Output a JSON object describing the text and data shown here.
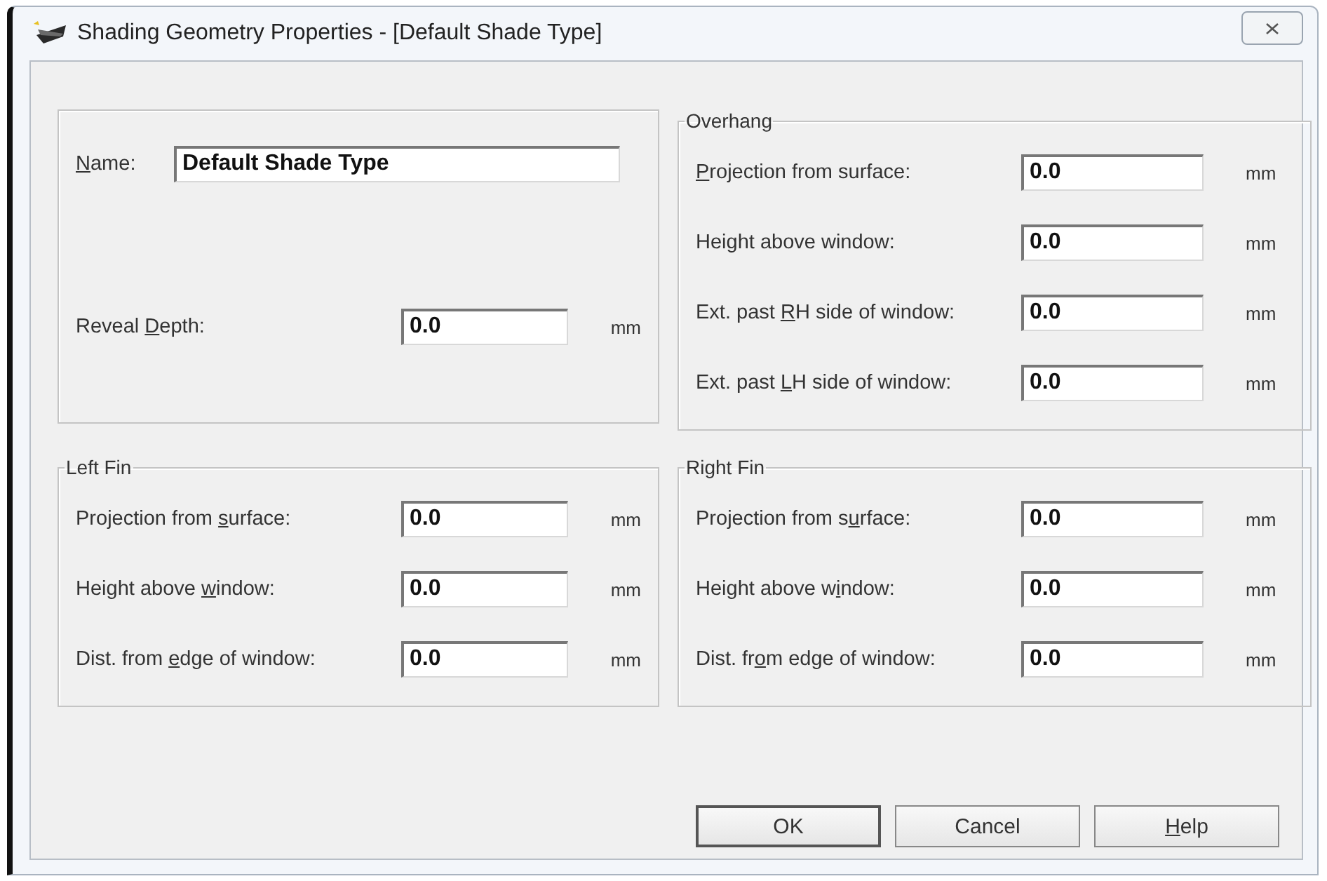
{
  "window": {
    "title": "Shading Geometry Properties - [Default Shade Type]"
  },
  "general": {
    "fields": [
      {
        "kind": "text",
        "key": "N",
        "post": "ame:",
        "value": "Default Shade Type"
      },
      {
        "kind": "measure",
        "pre": "Reveal ",
        "key": "D",
        "post": "epth:",
        "value": "0.0",
        "unit": "mm"
      }
    ]
  },
  "groups": [
    {
      "title": "Overhang",
      "fields": [
        {
          "kind": "measure",
          "key": "P",
          "post": "rojection from surface:",
          "value": "0.0",
          "unit": "mm"
        },
        {
          "kind": "measure",
          "pre": "Height above window:",
          "value": "0.0",
          "unit": "mm"
        },
        {
          "kind": "measure",
          "pre": "Ext. past ",
          "key": "R",
          "post": "H side of window:",
          "value": "0.0",
          "unit": "mm"
        },
        {
          "kind": "measure",
          "pre": "Ext. past ",
          "key": "L",
          "post": "H side of window:",
          "value": "0.0",
          "unit": "mm"
        }
      ]
    },
    {
      "title": "Left Fin",
      "fields": [
        {
          "kind": "measure",
          "pre": "Projection from ",
          "key": "s",
          "post": "urface:",
          "value": "0.0",
          "unit": "mm"
        },
        {
          "kind": "measure",
          "pre": "Height above ",
          "key": "w",
          "post": "indow:",
          "value": "0.0",
          "unit": "mm"
        },
        {
          "kind": "measure",
          "pre": "Dist. from ",
          "key": "e",
          "post": "dge of window:",
          "value": "0.0",
          "unit": "mm"
        }
      ]
    },
    {
      "title": "Right Fin",
      "fields": [
        {
          "kind": "measure",
          "pre": "Projection from s",
          "key": "u",
          "post": "rface:",
          "value": "0.0",
          "unit": "mm"
        },
        {
          "kind": "measure",
          "pre": "Height above w",
          "key": "i",
          "post": "ndow:",
          "value": "0.0",
          "unit": "mm"
        },
        {
          "kind": "measure",
          "pre": "Dist. fr",
          "key": "o",
          "post": "m edge of window:",
          "value": "0.0",
          "unit": "mm"
        }
      ]
    }
  ],
  "buttons": [
    {
      "pre": "OK",
      "default": true
    },
    {
      "pre": "Cancel",
      "default": false
    },
    {
      "key": "H",
      "post": "elp",
      "default": false
    }
  ]
}
